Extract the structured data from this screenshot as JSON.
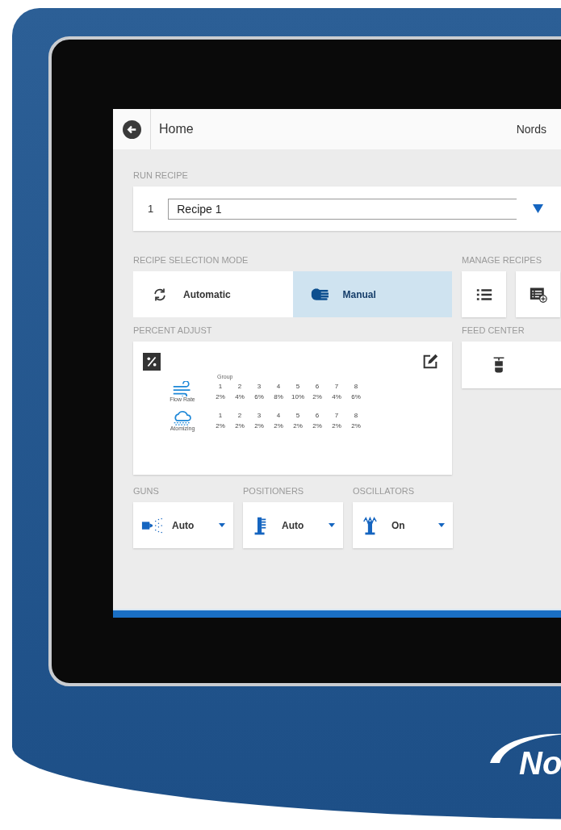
{
  "header": {
    "title": "Home",
    "brand": "Nords"
  },
  "run_recipe": {
    "title": "RUN RECIPE",
    "number": "1",
    "value": "Recipe 1"
  },
  "selection_mode": {
    "title": "RECIPE SELECTION MODE",
    "options": [
      {
        "label": "Automatic",
        "kind": "automatic",
        "selected": false
      },
      {
        "label": "Manual",
        "kind": "manual",
        "selected": true
      }
    ]
  },
  "manage_recipes": {
    "title": "MANAGE RECIPES",
    "buttons": [
      {
        "kind": "list"
      },
      {
        "kind": "add"
      }
    ]
  },
  "percent_adjust": {
    "title": "PERCENT ADJUST",
    "group_label": "Group",
    "rows": [
      {
        "label": "Flow Rate",
        "kind": "flow",
        "groups": [
          "1",
          "2",
          "3",
          "4",
          "5",
          "6",
          "7",
          "8"
        ],
        "values": [
          "2%",
          "4%",
          "6%",
          "8%",
          "10%",
          "2%",
          "4%",
          "6%"
        ]
      },
      {
        "label": "Atomizing",
        "kind": "atomizing",
        "groups": [
          "1",
          "2",
          "3",
          "4",
          "5",
          "6",
          "7",
          "8"
        ],
        "values": [
          "2%",
          "2%",
          "2%",
          "2%",
          "2%",
          "2%",
          "2%",
          "2%"
        ]
      }
    ]
  },
  "feed_center": {
    "title": "FEED CENTER"
  },
  "controls": [
    {
      "title": "GUNS",
      "value": "Auto",
      "kind": "guns"
    },
    {
      "title": "POSITIONERS",
      "value": "Auto",
      "kind": "positioners"
    },
    {
      "title": "OSCILLATORS",
      "value": "On",
      "kind": "oscillators"
    }
  ],
  "logo": {
    "text": "No"
  }
}
